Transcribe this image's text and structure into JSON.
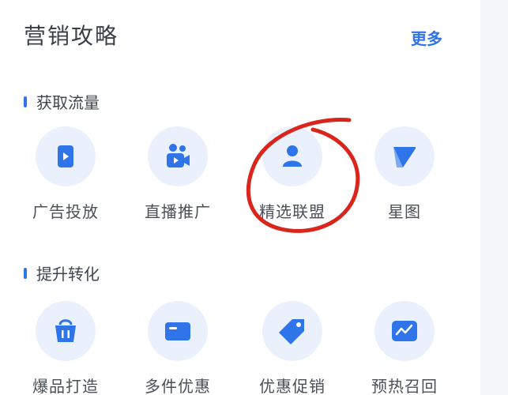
{
  "header": {
    "title": "营销攻略",
    "more_label": "更多"
  },
  "sections": [
    {
      "label": "获取流量",
      "items": [
        {
          "label": "广告投放",
          "icon": "video-play-icon"
        },
        {
          "label": "直播推广",
          "icon": "live-camera-icon"
        },
        {
          "label": "精选联盟",
          "icon": "user-icon"
        },
        {
          "label": "星图",
          "icon": "star-map-icon"
        }
      ]
    },
    {
      "label": "提升转化",
      "items": [
        {
          "label": "爆品打造",
          "icon": "basket-icon"
        },
        {
          "label": "多件优惠",
          "icon": "card-icon"
        },
        {
          "label": "优惠促销",
          "icon": "tag-icon"
        },
        {
          "label": "预热召回",
          "icon": "trend-chart-icon"
        }
      ]
    }
  ],
  "colors": {
    "accent": "#2f74e8",
    "icon_bg": "#eaf1fd",
    "annotation": "#d9261c"
  }
}
